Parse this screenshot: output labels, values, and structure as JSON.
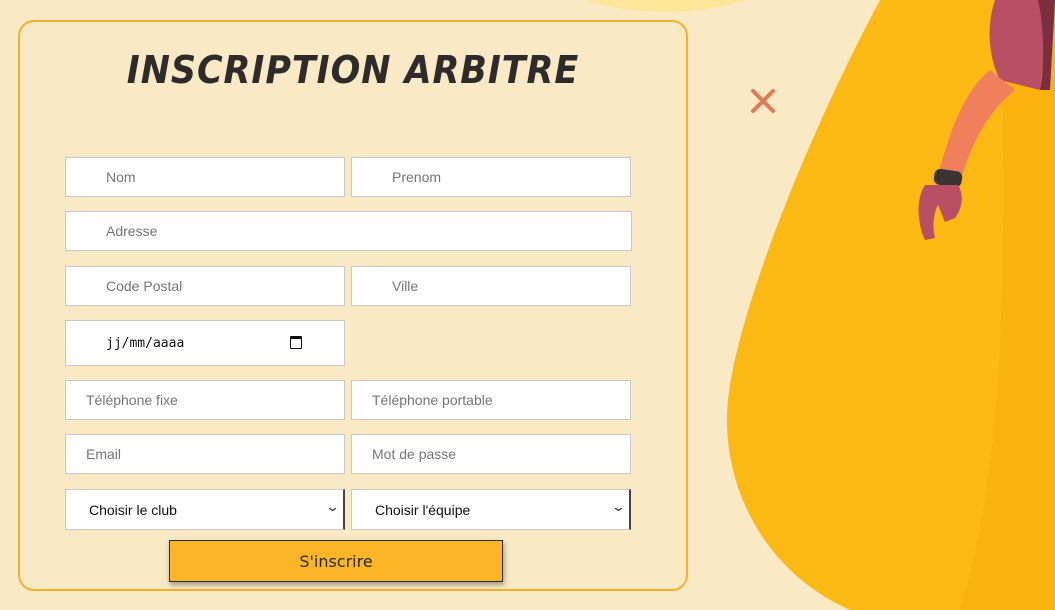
{
  "form": {
    "title": "INSCRIPTION ARBITRE",
    "fields": {
      "nom": "Nom",
      "prenom": "Prenom",
      "adresse": "Adresse",
      "code_postal": "Code Postal",
      "ville": "Ville",
      "date": "jj/mm/aaaa",
      "tel_fixe": "Téléphone fixe",
      "tel_portable": "Téléphone portable",
      "email": "Email",
      "password": "Mot de passe"
    },
    "selects": {
      "club": "Choisir le club",
      "equipe": "Choisir l'équipe"
    },
    "submit_label": "S'inscrire"
  },
  "colors": {
    "background": "#f9e9c5",
    "accent": "#fbb526",
    "close": "#e07a57"
  },
  "icons": {
    "close": "close-icon",
    "calendar": "calendar-icon",
    "chevron": "chevron-down-icon"
  }
}
